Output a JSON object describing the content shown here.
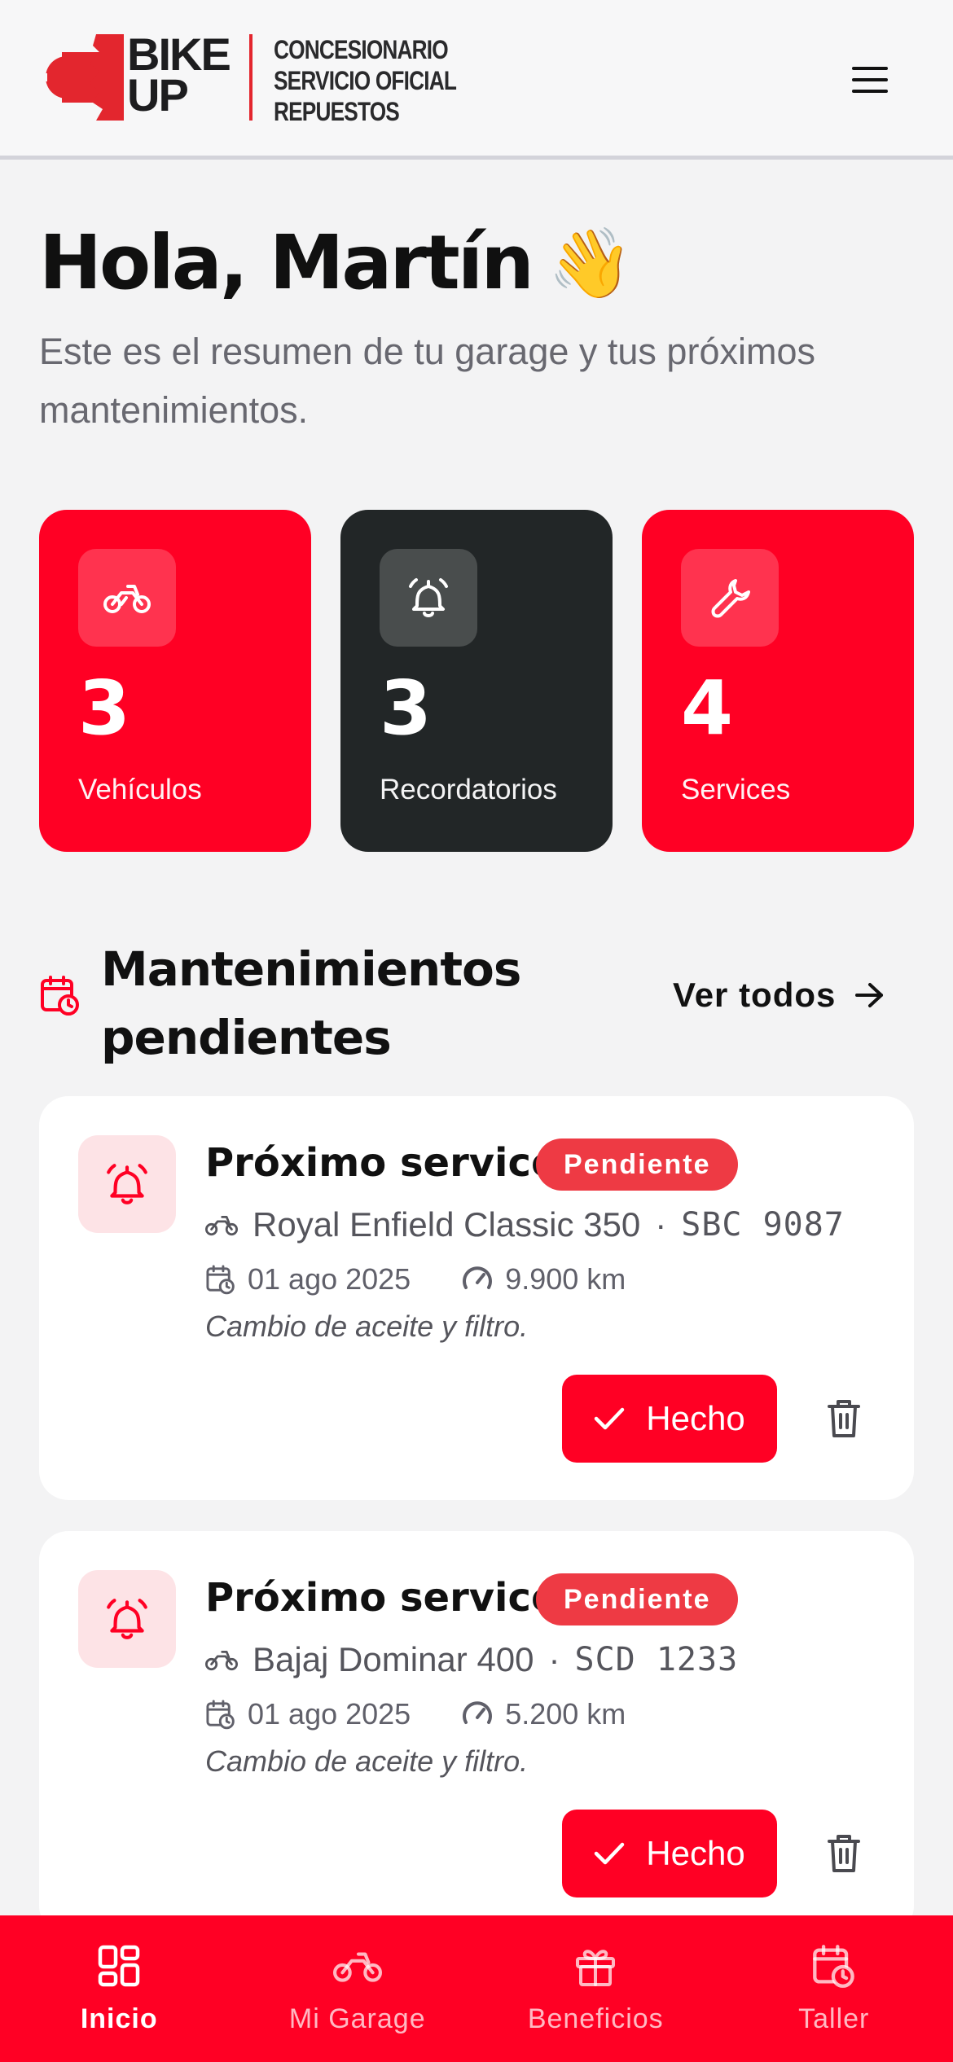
{
  "header": {
    "brand_line1": "BIKE",
    "brand_line2": "UP",
    "subtitle": [
      "CONCESIONARIO",
      "SERVICIO OFICIAL",
      "REPUESTOS"
    ]
  },
  "greeting": {
    "title": "Hola, Martín",
    "emoji": "👋",
    "subtitle": "Este es el resumen de tu garage y tus próximos mantenimientos."
  },
  "stats": [
    {
      "icon": "motorcycle-icon",
      "value": "3",
      "label": "Vehículos",
      "color": "#ff0024"
    },
    {
      "icon": "bell-icon",
      "value": "3",
      "label": "Recordatorios",
      "color": "#222627"
    },
    {
      "icon": "wrench-icon",
      "value": "4",
      "label": "Services",
      "color": "#ff0024"
    }
  ],
  "section": {
    "title": "Mantenimientos pendientes",
    "see_all": "Ver todos"
  },
  "maintenance": [
    {
      "title": "Próximo service",
      "status": "Pendiente",
      "vehicle": "Royal Enfield Classic 350",
      "separator": "·",
      "plate": "SBC 9087",
      "date": "01 ago 2025",
      "km": "9.900 km",
      "note": "Cambio de aceite y filtro.",
      "done_label": "Hecho"
    },
    {
      "title": "Próximo service",
      "status": "Pendiente",
      "vehicle": "Bajaj Dominar 400",
      "separator": "·",
      "plate": "SCD 1233",
      "date": "01 ago 2025",
      "km": "5.200 km",
      "note": "Cambio de aceite y filtro.",
      "done_label": "Hecho"
    }
  ],
  "nav": [
    {
      "label": "Inicio",
      "icon": "grid-icon",
      "active": true
    },
    {
      "label": "Mi Garage",
      "icon": "motorcycle-icon",
      "active": false
    },
    {
      "label": "Beneficios",
      "icon": "gift-icon",
      "active": false
    },
    {
      "label": "Taller",
      "icon": "calendar-clock-icon",
      "active": false
    }
  ],
  "colors": {
    "accent": "#ff0024",
    "dark": "#222627",
    "badge": "#ee3a44",
    "background": "#f3f3f4"
  }
}
